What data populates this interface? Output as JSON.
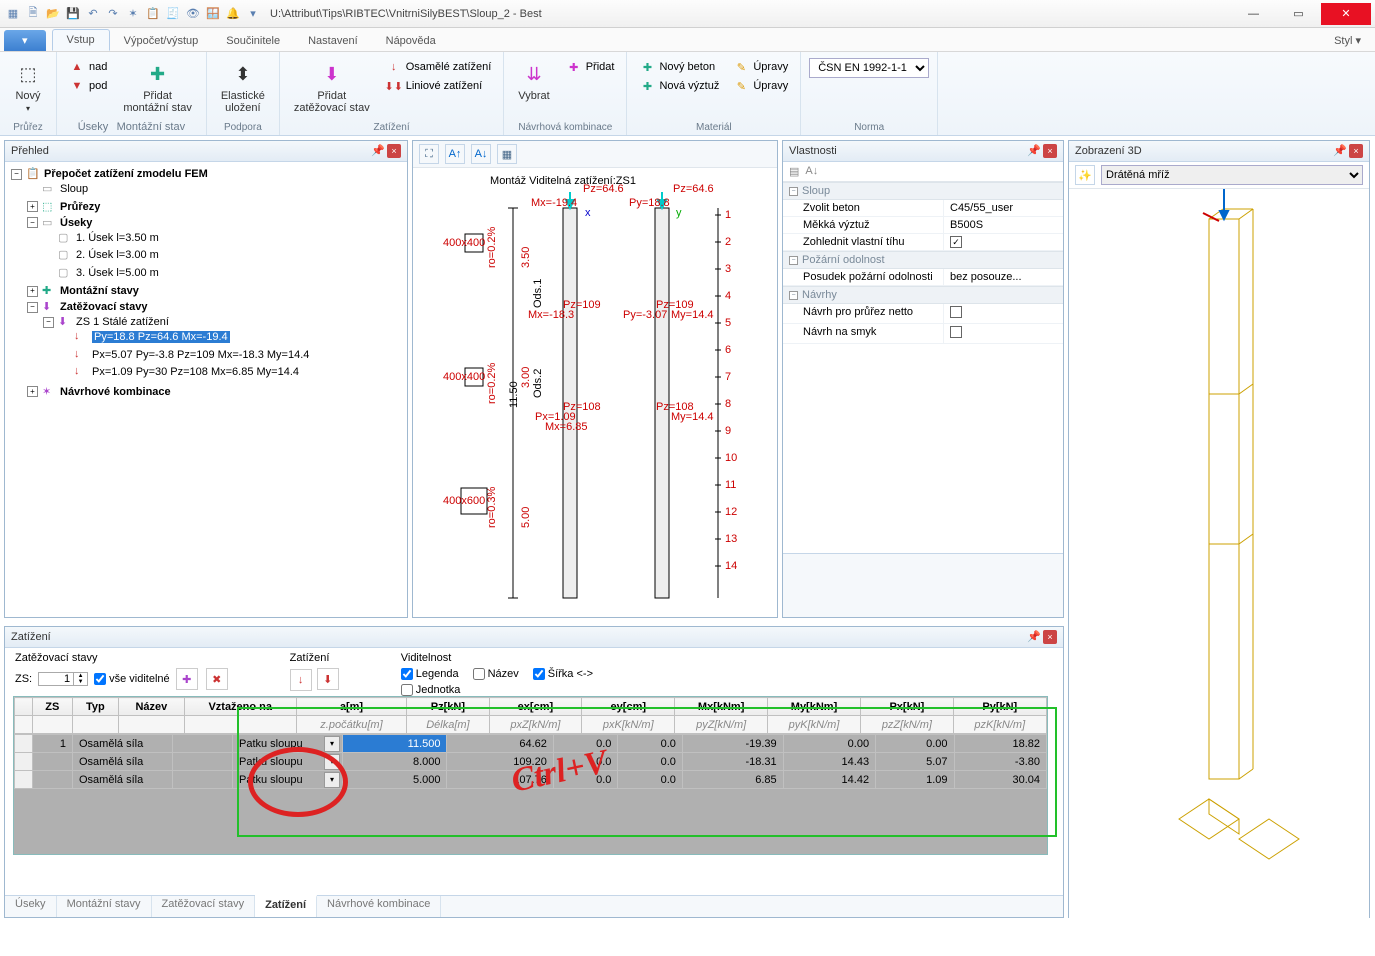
{
  "title": "U:\\Attribut\\Tips\\RIBTEC\\VnitrniSilyBEST\\Sloup_2 - Best",
  "ribbon": {
    "tabs": [
      "Vstup",
      "Výpočet/výstup",
      "Součinitele",
      "Nastavení",
      "Nápověda"
    ],
    "style": "Styl",
    "groups": {
      "prurez": {
        "title": "Průřez",
        "new": "Nový"
      },
      "useky": {
        "title": "Úseky",
        "nad": "nad",
        "pod": "pod",
        "montaz": "Přidat\nmontážní stav",
        "montaz_sub": "Montážní stav"
      },
      "podpora": {
        "title": "Podpora",
        "elast": "Elastické\nuložení"
      },
      "zatizeni": {
        "title": "Zatížení",
        "stav": "Přidat\nzatěžovací stav",
        "osam": "Osamělé zatížení",
        "lin": "Liniové zatížení"
      },
      "komb": {
        "title": "Návrhová kombinace",
        "pridat": "Přidat",
        "vybrat": "Vybrat"
      },
      "material": {
        "title": "Materiál",
        "beton": "Nový beton",
        "vyztuz": "Nová výztuž",
        "upravy": "Úpravy"
      },
      "norma": {
        "title": "Norma",
        "value": "ČSN EN 1992-1-1"
      }
    }
  },
  "tree": {
    "title": "Přehled",
    "root": "Přepočet zatížení zmodelu  FEM",
    "sloup": "Sloup",
    "prurezy": "Průřezy",
    "useky": "Úseky",
    "usek_items": [
      "1. Úsek  l=3.50 m",
      "2. Úsek  l=3.00 m",
      "3. Úsek  l=5.00 m"
    ],
    "montaz": "Montážní stavy",
    "zat_stavy": "Zatěžovací stavy",
    "zs1": "ZS 1 Stálé zatížení",
    "zs1_items": [
      "Py=18.8 Pz=64.6 Mx=-19.4",
      "Px=5.07 Py=-3.8 Pz=109 Mx=-18.3 My=14.4",
      "Px=1.09 Py=30 Pz=108 Mx=6.85 My=14.4"
    ],
    "navrh": "Návrhové kombinace"
  },
  "properties": {
    "title": "Vlastnosti",
    "cats": {
      "sloup": "Sloup",
      "pozar": "Požární odolnost",
      "navrhy": "Návrhy"
    },
    "rows": {
      "beton_k": "Zvolit beton",
      "beton_v": "C45/55_user",
      "vyztuz_k": "Měkká výztuž",
      "vyztuz_v": "B500S",
      "vlastni_k": "Zohlednit vlastní tíhu",
      "pozar_k": "Posudek požární odolnosti",
      "pozar_v": "bez posouze...",
      "netto_k": "Návrh pro průřez netto",
      "smyk_k": "Návrh na smyk"
    }
  },
  "view3d": {
    "title": "Zobrazení 3D",
    "mode": "Drátěná mříž"
  },
  "graphic": {
    "caption": "Montáž  Viditelná zatížení:ZS1",
    "sections": [
      "400x400",
      "400x400",
      "400x600"
    ],
    "heights": [
      "3.50",
      "3.00",
      "5.00"
    ],
    "total": "11.50",
    "annot": {
      "top": {
        "mx": "Mx=-19.4",
        "pz": "Pz=64.6",
        "py": "Py=18.8"
      },
      "mid1": {
        "mx": "Mx=-18.3",
        "pz": "Pz=109",
        "py": "Py=-3.07",
        "my": "My=14.4"
      },
      "mid2": {
        "px": "Px=1.09",
        "pz": "Pz=108",
        "mx": "Mx=6.85",
        "my": "My=14.4"
      }
    },
    "ro": [
      "ro=0.2%",
      "ro=0.2%",
      "ro=0.3%"
    ],
    "ruler": [
      "1",
      "2",
      "3",
      "4",
      "5",
      "6",
      "7",
      "8",
      "9",
      "10",
      "11",
      "12",
      "13",
      "14"
    ]
  },
  "zat_panel": {
    "title": "Zatížení",
    "heads": {
      "stavy": "Zatěžovací stavy",
      "zat": "Zatížení",
      "vid": "Viditelnost"
    },
    "zs_label": "ZS:",
    "zs_value": "1",
    "vse": "vše viditelné",
    "legend": "Legenda",
    "nazev": "Název",
    "sirka": "Šířka <->",
    "jednotka": "Jednotka",
    "cols": [
      "ZS",
      "Typ",
      "Název",
      "Vztaženo na",
      "a[m]",
      "Pz[kN]",
      "ex[cm]",
      "ey[cm]",
      "Mx[kNm]",
      "My[kNm]",
      "Px[kN]",
      "Py[kN]"
    ],
    "subcols": [
      "",
      "",
      "",
      "",
      "z.počátku[m]",
      "Délka[m]",
      "pxZ[kN/m]",
      "pxK[kN/m]",
      "pyZ[kN/m]",
      "pyK[kN/m]",
      "pzZ[kN/m]",
      "pzK[kN/m]"
    ],
    "rows": [
      {
        "zs": "1",
        "typ": "Osamělá síla",
        "nazev": "",
        "ref": "Patku sloupu",
        "a": "11.500",
        "pz": "64.62",
        "ex": "0.0",
        "ey": "0.0",
        "mx": "-19.39",
        "my": "0.00",
        "px": "0.00",
        "py": "18.82"
      },
      {
        "zs": "",
        "typ": "Osamělá síla",
        "nazev": "",
        "ref": "Patku sloupu",
        "a": "8.000",
        "pz": "109.20",
        "ex": "0.0",
        "ey": "0.0",
        "mx": "-18.31",
        "my": "14.43",
        "px": "5.07",
        "py": "-3.80"
      },
      {
        "zs": "",
        "typ": "Osamělá síla",
        "nazev": "",
        "ref": "Patku sloupu",
        "a": "5.000",
        "pz": "107.76",
        "ex": "0.0",
        "ey": "0.0",
        "mx": "6.85",
        "my": "14.42",
        "px": "1.09",
        "py": "30.04"
      }
    ],
    "ctrlv": "Ctrl+V"
  },
  "footer_tabs": [
    "Úseky",
    "Montážní stavy",
    "Zatěžovací stavy",
    "Zatížení",
    "Návrhové kombinace"
  ]
}
